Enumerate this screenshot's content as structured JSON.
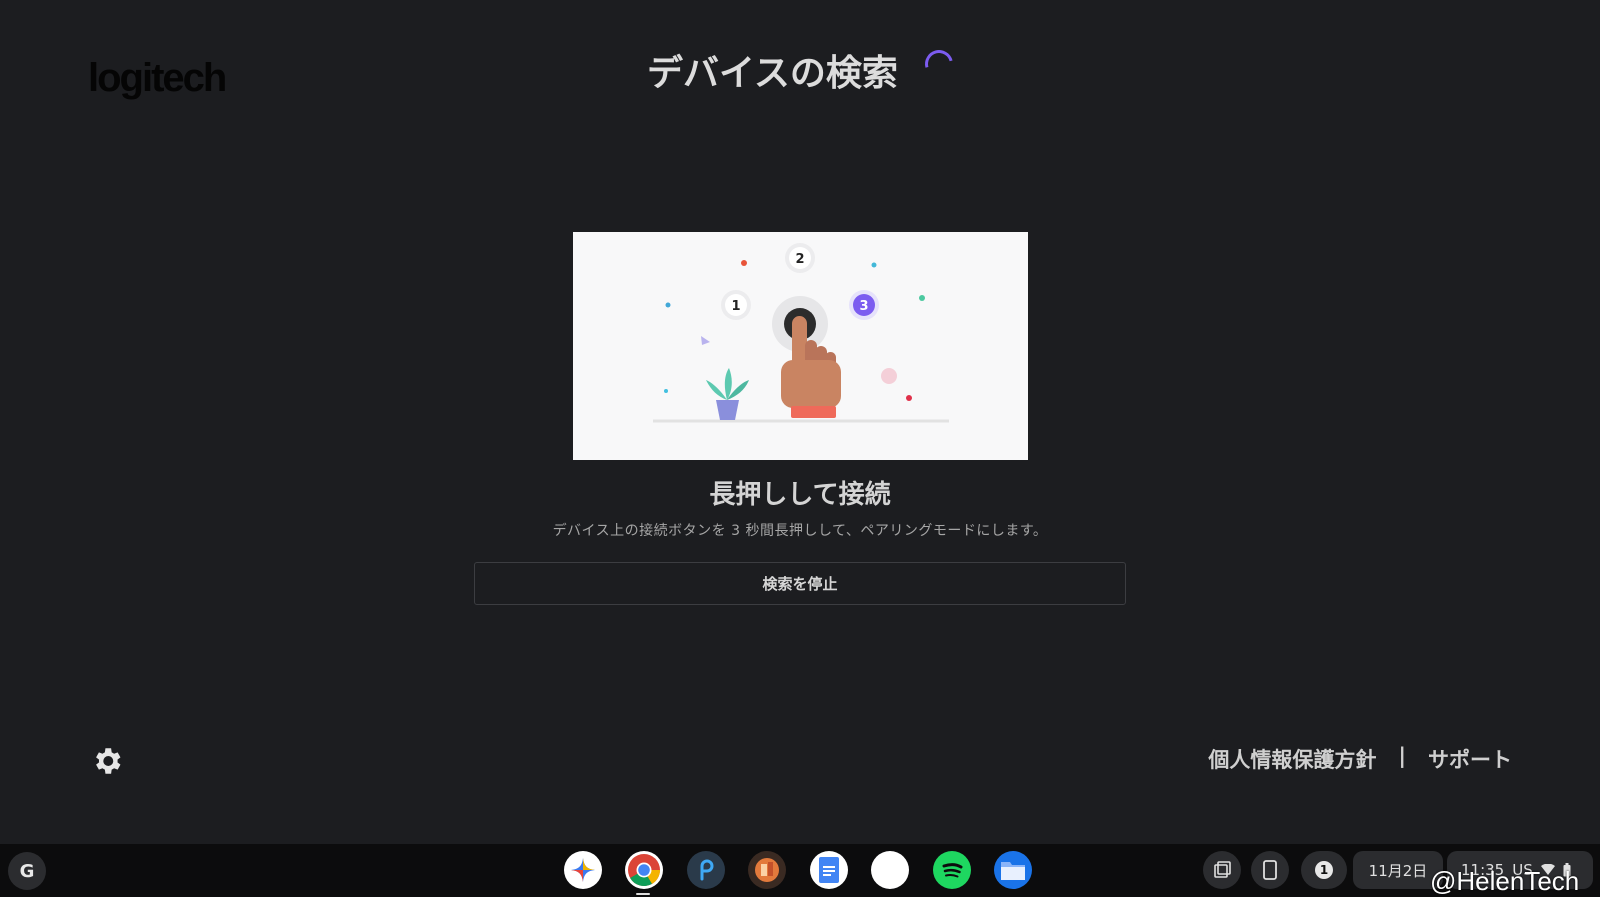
{
  "app": {
    "logo_text": "logitech",
    "title": "デバイスの検索",
    "illustration": {
      "steps": [
        "1",
        "2",
        "3"
      ]
    },
    "heading": "長押しして接続",
    "description": "デバイス上の接続ボタンを 3 秒間長押しして、ペアリングモードにします。",
    "stop_button_label": "検索を停止",
    "footer": {
      "privacy_label": "個人情報保護方針",
      "separator": "|",
      "support_label": "サポート"
    },
    "accent_color": "#7c5cf0"
  },
  "shelf": {
    "launcher_label": "G",
    "apps": [
      "gemini-icon",
      "chrome-icon",
      "picsart-icon",
      "tinkercad-icon",
      "docs-icon",
      "blank-app-icon",
      "spotify-icon",
      "files-icon"
    ],
    "tray": {
      "notification_count": "1",
      "date": "11月2日",
      "time": "11:35",
      "ime": "US"
    },
    "watermark": "@HelenTech"
  }
}
